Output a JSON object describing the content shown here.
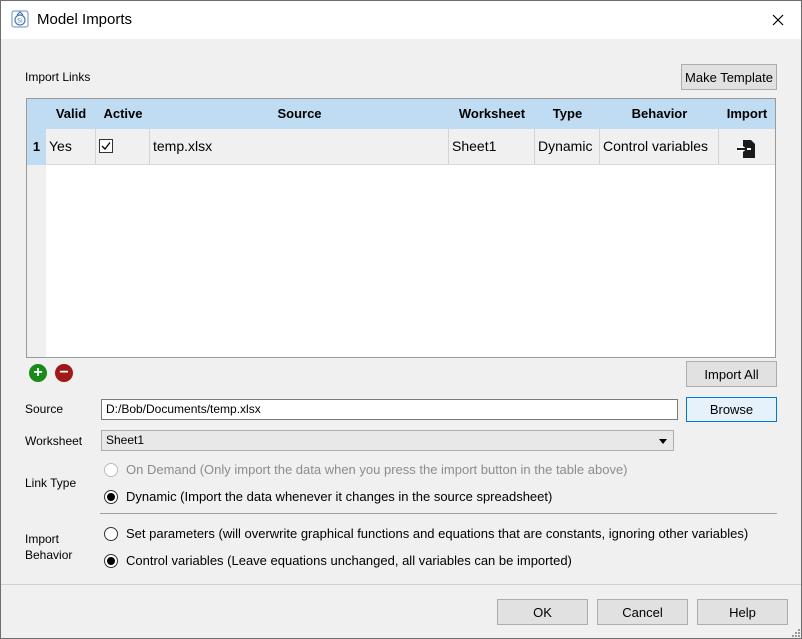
{
  "window": {
    "title": "Model Imports",
    "close_glyph": "✕"
  },
  "import_links": {
    "label": "Import Links",
    "make_template_label": "Make Template",
    "columns": [
      "Valid",
      "Active",
      "Source",
      "Worksheet",
      "Type",
      "Behavior",
      "Import"
    ],
    "rows": [
      {
        "num": "1",
        "valid": "Yes",
        "active": true,
        "source": "temp.xlsx",
        "worksheet": "Sheet1",
        "type": "Dynamic",
        "behavior": "Control variables",
        "import_icon": "import-icon"
      }
    ],
    "add_glyph": "+",
    "remove_glyph": "−",
    "import_all_label": "Import All"
  },
  "source": {
    "label": "Source",
    "value": "D:/Bob/Documents/temp.xlsx",
    "browse_label": "Browse"
  },
  "worksheet": {
    "label": "Worksheet",
    "value": "Sheet1"
  },
  "link_type": {
    "label": "Link Type",
    "options": [
      {
        "text": "On Demand (Only import the data when you press the import button in the table above)",
        "checked": false,
        "disabled": true
      },
      {
        "text": "Dynamic (Import the data whenever it changes in the source spreadsheet)",
        "checked": true,
        "disabled": false
      }
    ]
  },
  "import_behavior": {
    "label_line1": "Import",
    "label_line2": "Behavior",
    "options": [
      {
        "text": "Set parameters (will overwrite graphical functions and equations that are constants, ignoring other variables)",
        "checked": false
      },
      {
        "text": "Control variables (Leave equations unchanged, all variables can be imported)",
        "checked": true
      }
    ]
  },
  "footer": {
    "ok_label": "OK",
    "cancel_label": "Cancel",
    "help_label": "Help"
  },
  "colors": {
    "header_blue": "#bfdcf2",
    "add_green": "#1a8a1a",
    "remove_red": "#a01818",
    "focus_blue": "#0078d7"
  }
}
